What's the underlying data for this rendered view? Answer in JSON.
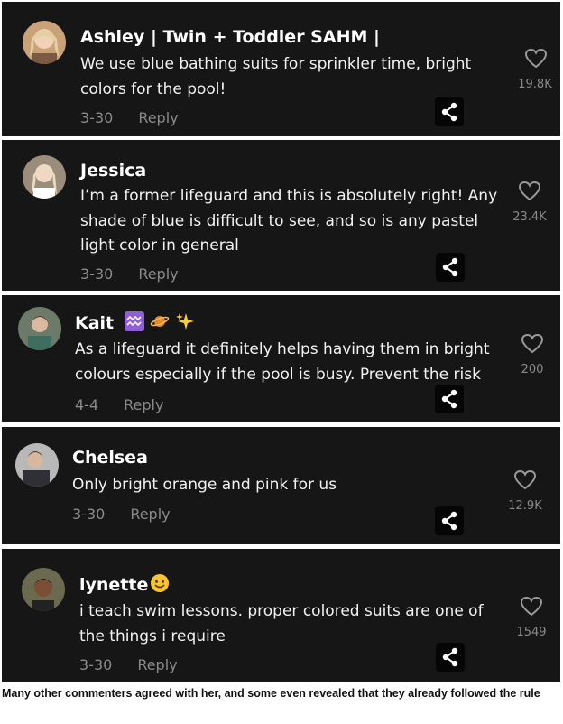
{
  "comments": [
    {
      "author": "Ashley | Twin + Toddler SAHM |",
      "text": "We use blue bathing suits for sprinkler time, bright colors for the pool!",
      "date": "3-30",
      "reply_label": "Reply",
      "likes": "19.8K"
    },
    {
      "author": "Jessica",
      "text": "I’m a former lifeguard and this is absolutely right! Any shade of blue is difficult to see, and so is any pastel light color in general",
      "date": "3-30",
      "reply_label": "Reply",
      "likes": "23.4K"
    },
    {
      "author": "Kait",
      "emojis": [
        "aquarius-icon",
        "planet-icon",
        "sparkles-icon"
      ],
      "text": "As a lifeguard it definitely helps having them in bright colours especially if the pool is busy. Prevent the risk",
      "date": "4-4",
      "reply_label": "Reply",
      "likes": "200"
    },
    {
      "author": "Chelsea",
      "text": "Only bright orange and pink for us",
      "date": "3-30",
      "reply_label": "Reply",
      "likes": "12.9K"
    },
    {
      "author": "lynette",
      "emojis": [
        "smiling-face-icon"
      ],
      "text": "i teach swim lessons. proper colored suits are one of the things i require",
      "date": "3-30",
      "reply_label": "Reply",
      "likes": "1549"
    }
  ],
  "caption": "Many other commenters agreed with her, and some even revealed that they already followed the rule",
  "colors": {
    "card_background": "#161616",
    "text": "#f2f2f2",
    "muted": "#8a8a8a",
    "page_background": "#ffffff"
  }
}
